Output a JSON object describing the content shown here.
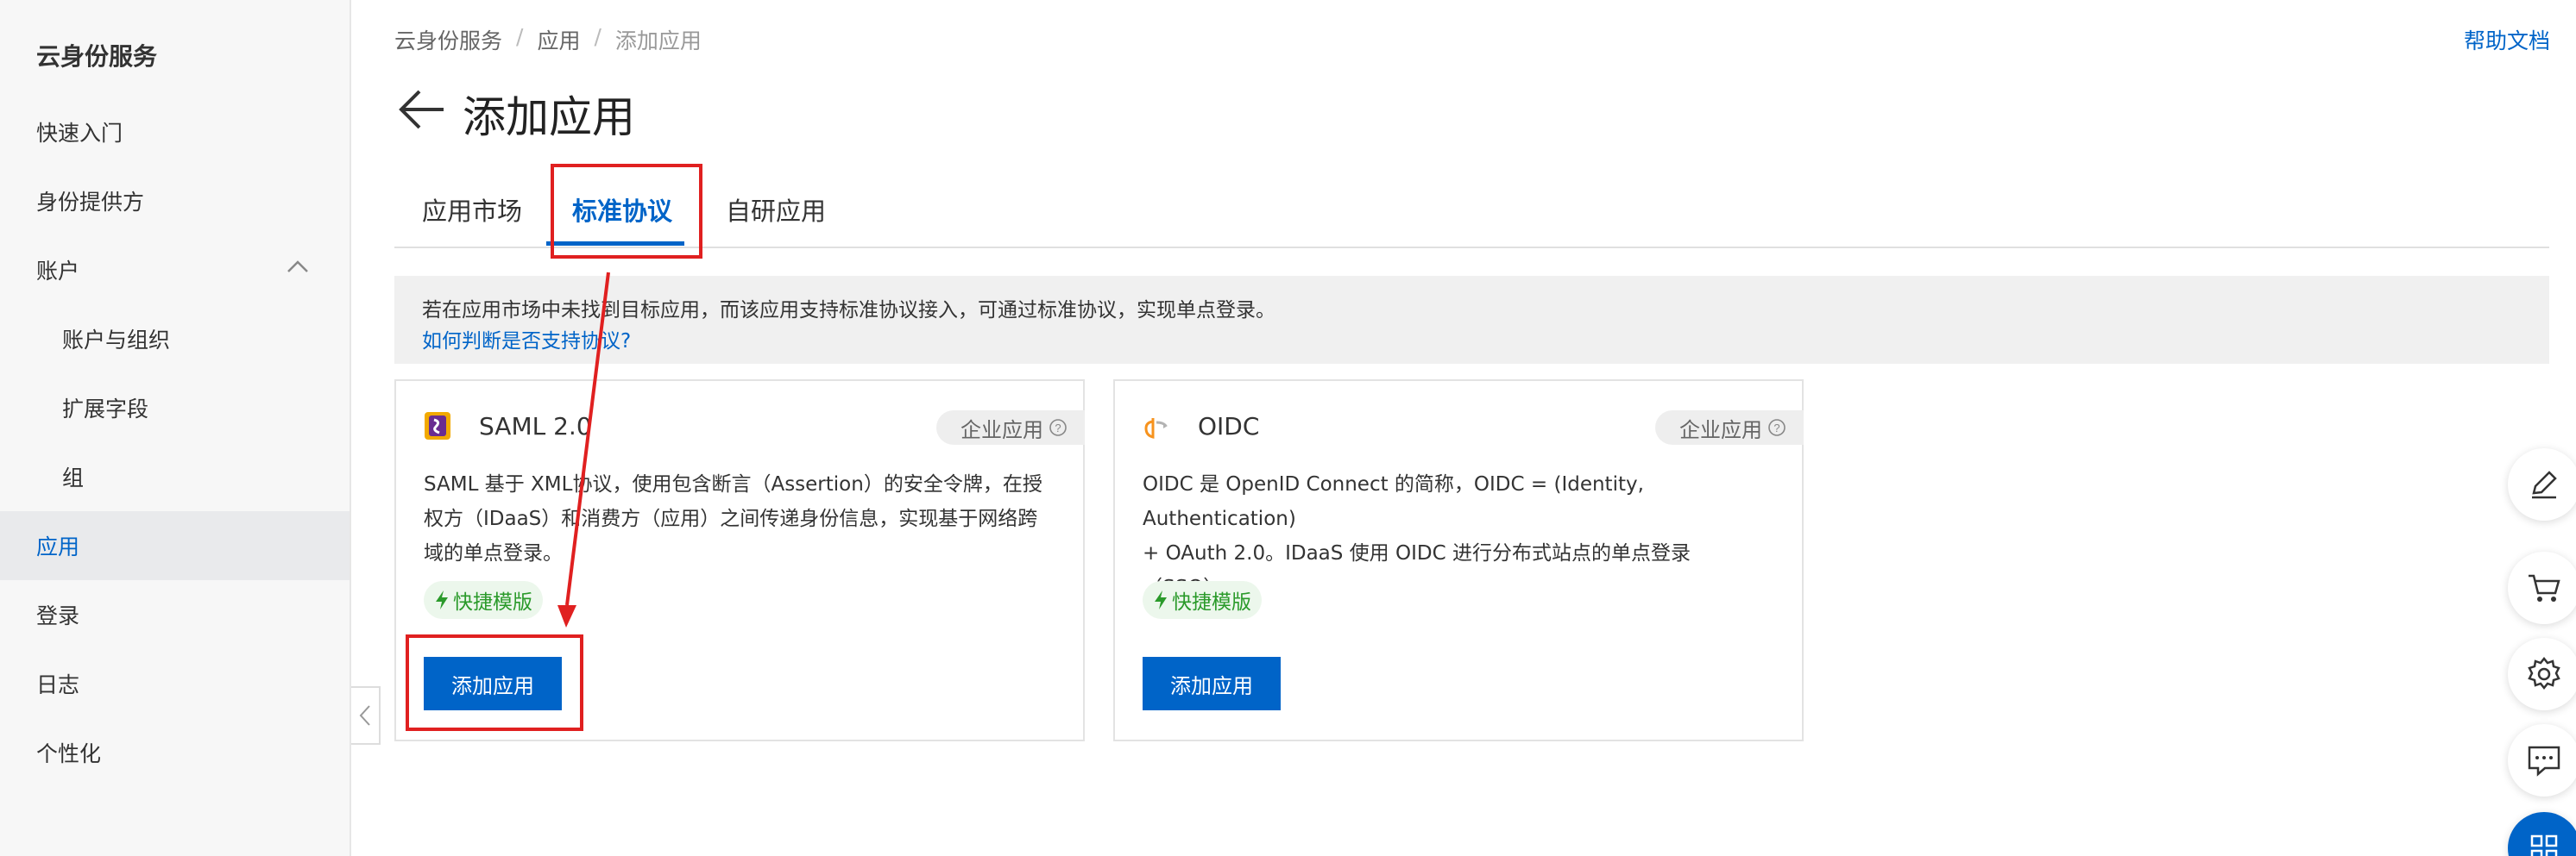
{
  "sidebar": {
    "title": "云身份服务",
    "items": [
      {
        "label": "快速入门"
      },
      {
        "label": "身份提供方"
      },
      {
        "label": "账户"
      },
      {
        "label": "账户与组织"
      },
      {
        "label": "扩展字段"
      },
      {
        "label": "组"
      },
      {
        "label": "应用"
      },
      {
        "label": "登录"
      },
      {
        "label": "日志"
      },
      {
        "label": "个性化"
      }
    ],
    "active_item": "应用"
  },
  "breadcrumb": [
    "云身份服务",
    "应用",
    "添加应用"
  ],
  "breadcrumb_separator": "/",
  "help_link": "帮助文档",
  "page_title": "添加应用",
  "tabs": [
    {
      "label": "应用市场"
    },
    {
      "label": "标准协议"
    },
    {
      "label": "自研应用"
    }
  ],
  "active_tab": "标准协议",
  "notice": {
    "text": "若在应用市场中未找到目标应用，而该应用支持标准协议接入，可通过标准协议，实现单点登录。",
    "link": "如何判断是否支持协议?"
  },
  "cards": [
    {
      "name": "SAML 2.0",
      "icon": "saml-icon",
      "tag": "企业应用",
      "desc_lines": [
        "SAML 基于 XML协议，使用包含断言（Assertion）的安全令牌，在授",
        "权方（IDaaS）和消费方（应用）之间传递身份信息，实现基于网络跨",
        "域的单点登录。"
      ],
      "quick_tag": "快捷模版",
      "button": "添加应用"
    },
    {
      "name": "OIDC",
      "icon": "oidc-icon",
      "tag": "企业应用",
      "desc_lines": [
        "OIDC 是 OpenID Connect 的简称，OIDC = (Identity, Authentication)",
        "+ OAuth 2.0。IDaaS 使用 OIDC 进行分布式站点的单点登录",
        "（SSO）。"
      ],
      "quick_tag": "快捷模版",
      "button": "添加应用"
    }
  ],
  "float_toolbar": [
    "edit-icon",
    "cart-icon",
    "settings-icon",
    "chat-icon",
    "apps-icon"
  ],
  "colors": {
    "primary": "#0064c8",
    "annotation": "#e02020",
    "quick_tag_text": "#2a9a2a",
    "sidebar_bg": "#f7f7f7"
  }
}
